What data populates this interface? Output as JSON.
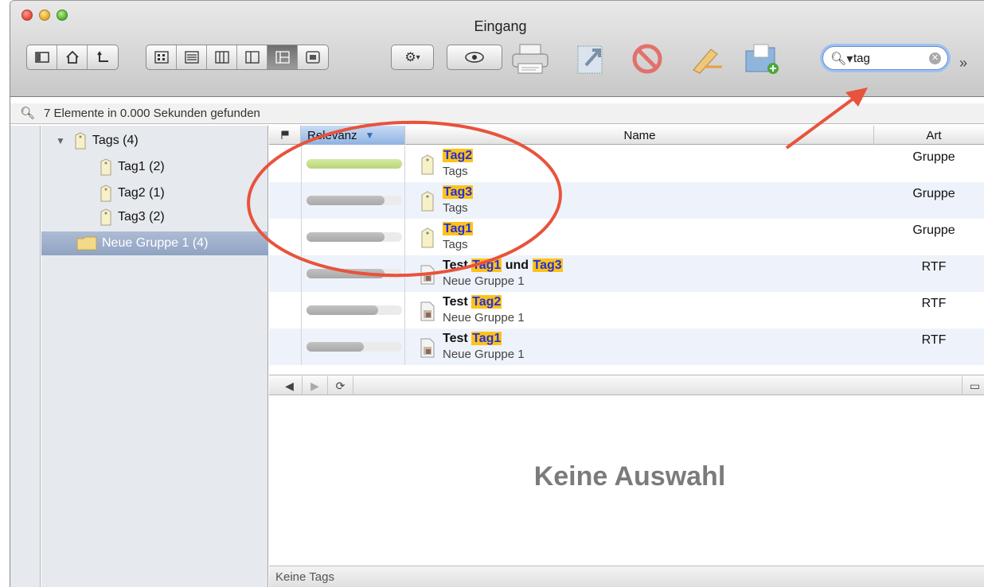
{
  "window": {
    "title": "Eingang"
  },
  "toolbar": {
    "nav_buttons": [
      "sidebar-toggle",
      "home",
      "back"
    ],
    "view_buttons": [
      "icon-view",
      "list-view",
      "column-view",
      "split-view",
      "three-pane-view",
      "preview-view"
    ],
    "action_menu": "gear",
    "search": {
      "value": "tag"
    }
  },
  "status": {
    "text": "7 Elemente in 0.000 Sekunden gefunden"
  },
  "sidebar": {
    "items": [
      {
        "label": "Tags (4)",
        "level": 0,
        "expanded": true,
        "icon": "tag-icon"
      },
      {
        "label": "Tag1 (2)",
        "level": 1,
        "icon": "tag-icon"
      },
      {
        "label": "Tag2 (1)",
        "level": 1,
        "icon": "tag-icon"
      },
      {
        "label": "Tag3 (2)",
        "level": 1,
        "icon": "tag-icon"
      },
      {
        "label": "Neue Gruppe 1 (4)",
        "level": 0,
        "selected": true,
        "icon": "folder-icon"
      }
    ]
  },
  "table": {
    "columns": {
      "relevance": "Relevanz",
      "name": "Name",
      "kind": "Art"
    },
    "rows": [
      {
        "relevance": 1.0,
        "parts": [
          {
            "t": "Tag2",
            "hl": true
          }
        ],
        "subtitle": "Tags",
        "kind": "Gruppe",
        "icon": "tag-icon"
      },
      {
        "relevance": 0.82,
        "parts": [
          {
            "t": "Tag3",
            "hl": true
          }
        ],
        "subtitle": "Tags",
        "kind": "Gruppe",
        "icon": "tag-icon"
      },
      {
        "relevance": 0.82,
        "parts": [
          {
            "t": "Tag1",
            "hl": true
          }
        ],
        "subtitle": "Tags",
        "kind": "Gruppe",
        "icon": "tag-icon"
      },
      {
        "relevance": 0.82,
        "parts": [
          {
            "t": "Test ",
            "hl": false
          },
          {
            "t": "Tag1",
            "hl": true
          },
          {
            "t": " und ",
            "hl": false
          },
          {
            "t": "Tag3",
            "hl": true
          }
        ],
        "subtitle": "Neue Gruppe 1",
        "kind": "RTF",
        "icon": "rtf-document-icon"
      },
      {
        "relevance": 0.75,
        "parts": [
          {
            "t": "Test ",
            "hl": false
          },
          {
            "t": "Tag2",
            "hl": true
          }
        ],
        "subtitle": "Neue Gruppe 1",
        "kind": "RTF",
        "icon": "rtf-document-icon"
      },
      {
        "relevance": 0.6,
        "parts": [
          {
            "t": "Test ",
            "hl": false
          },
          {
            "t": "Tag1",
            "hl": true
          }
        ],
        "subtitle": "Neue Gruppe 1",
        "kind": "RTF",
        "icon": "rtf-document-icon"
      }
    ]
  },
  "preview": {
    "empty_text": "Keine Auswahl"
  },
  "tags_bar": {
    "text": "Keine Tags"
  },
  "colors": {
    "highlight_bg": "#ffc21a",
    "highlight_text": "#2330d8",
    "annotation": "#e8533c",
    "top_relevance": "#b8d67a"
  }
}
